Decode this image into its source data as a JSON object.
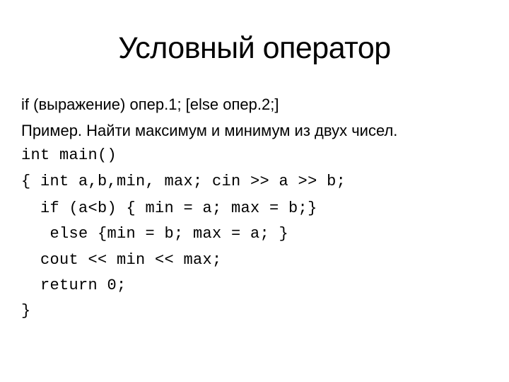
{
  "slide": {
    "title": "Условный оператор",
    "syntax": "if (выражение) опер.1; [else опер.2;]",
    "example": "Пример. Найти максимум и минимум из двух чисел.",
    "code_lines": [
      "int main()",
      "{ int a,b,min, max; cin >> a >> b;",
      "  if (a<b) { min = a; max = b;}",
      "   else {min = b; max = a; }",
      "  cout << min << max;",
      "  return 0;",
      "}"
    ]
  }
}
